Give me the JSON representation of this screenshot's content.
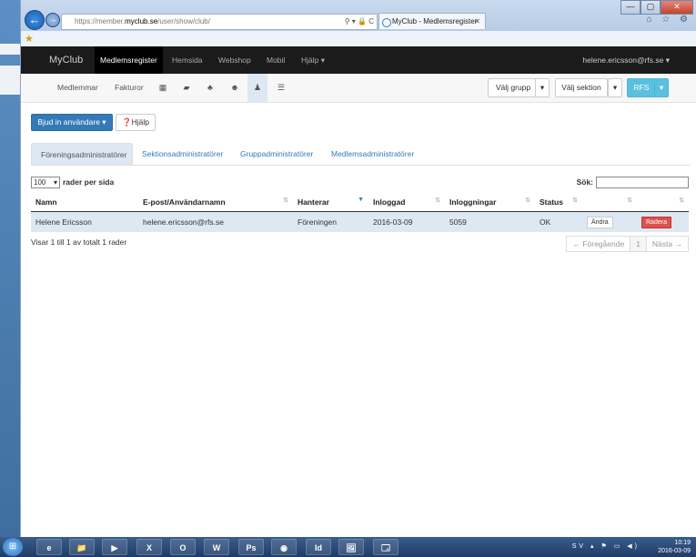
{
  "browser": {
    "back_icon": "←",
    "forward_icon": "→",
    "url_scheme": "https://member.",
    "url_host": "myclub.se",
    "url_path": "/user/show/club/",
    "address_controls": "⚲ ▾ 🔒 C",
    "tab_title": "MyClub - Medlemsregister",
    "tab_close": "✕",
    "window": {
      "minimize": "—",
      "maximize": "▢",
      "close": "✕"
    },
    "tools_icons": "⌂ ☆ ⚙"
  },
  "topnav": {
    "brand": "MyClub",
    "items": [
      "Medlemsregister",
      "Hemsida",
      "Webshop",
      "Mobil",
      "Hjälp ▾"
    ],
    "user": "helene.ericsson@rfs.se ▾"
  },
  "subnav": {
    "items": [
      "Medlemmar",
      "Fakturor"
    ],
    "icons": [
      "calendar-icon",
      "folder-icon",
      "sitemap-icon",
      "group-icon",
      "user-icon",
      "sliders-icon"
    ],
    "group_select": "Välj grupp",
    "section_select": "Välj sektion",
    "caret": "▾",
    "org_button": "RFS"
  },
  "actions": {
    "invite": "Bjud in användare ▾",
    "help": "Hjälp"
  },
  "tabs": [
    "Föreningsadministratörer",
    "Sektionsadministratörer",
    "Gruppadministratörer",
    "Medlemsadministratörer"
  ],
  "table": {
    "length_value": "100",
    "length_label": "rader per sida",
    "search_label": "Sök:",
    "columns": [
      "Namn",
      "E-post/Användarnamn",
      "Hanterar",
      "Inloggad",
      "Inloggningar",
      "Status",
      "",
      ""
    ],
    "rows": [
      {
        "name": "Helene Ericsson",
        "email": "helene.ericsson@rfs.se",
        "manages": "Föreningen",
        "last_login": "2016-03-09",
        "logins": "5059",
        "status": "OK",
        "edit": "Ändra",
        "delete": "Radera"
      }
    ],
    "info": "Visar 1 till 1 av totalt 1 rader",
    "pager": {
      "prev": "← Föregående",
      "page": "1",
      "next": "Nästa →"
    }
  },
  "taskbar": {
    "apps": [
      "e",
      "📁",
      "▶",
      "X",
      "O",
      "W",
      "Ps",
      "◉",
      "Id",
      "🖼",
      "🗔"
    ],
    "lang": "SV",
    "time": "10:19",
    "date": "2016-03-09"
  },
  "colors": {
    "accent": "#337ab7",
    "danger": "#d9534f",
    "nav_bg": "#1b1b1b",
    "row_highlight": "#dde8f2"
  }
}
